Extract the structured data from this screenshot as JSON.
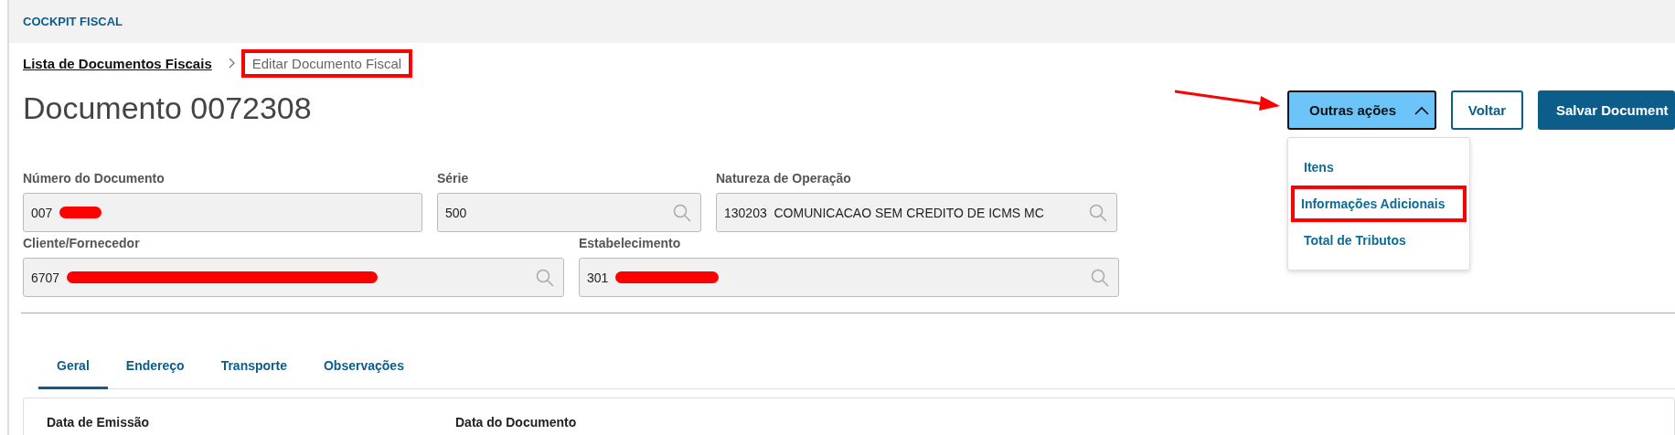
{
  "header": {
    "title": "COCKPIT FISCAL"
  },
  "breadcrumb": [
    {
      "label": "Lista de Documentos Fiscais",
      "current": false,
      "highlighted": false
    },
    {
      "label": "Editar Documento Fiscal",
      "current": true,
      "highlighted": true
    }
  ],
  "page_title": "Documento 0072308",
  "actions": [
    {
      "label": "Outras ações",
      "kind": "dropdown",
      "expanded": true,
      "pointed": true
    },
    {
      "label": "Voltar",
      "kind": "secondary",
      "pointed": false
    },
    {
      "label": "Salvar Document",
      "kind": "primary",
      "pointed": false
    }
  ],
  "dropdown_menu": [
    {
      "label": "Itens",
      "highlighted": false
    },
    {
      "label": "Informações Adicionais",
      "highlighted": true
    },
    {
      "label": "Total de Tributos",
      "highlighted": false
    }
  ],
  "field_rows": [
    [
      {
        "label": "Número do Documento",
        "value": "007",
        "redacted": true,
        "search": false
      },
      {
        "label": "Série",
        "value": "500",
        "redacted": false,
        "search": true
      },
      {
        "label": "Natureza de Operação",
        "value": "130203  COMUNICACAO SEM CREDITO DE ICMS MC",
        "redacted": false,
        "search": true
      }
    ],
    [
      {
        "label": "Cliente/Fornecedor",
        "value": "6707",
        "redacted": true,
        "search": true
      },
      {
        "label": "Estabelecimento",
        "value": "301",
        "redacted": true,
        "search": true
      }
    ]
  ],
  "tabs": [
    {
      "label": "Geral",
      "selected": true
    },
    {
      "label": "Endereço",
      "selected": false
    },
    {
      "label": "Transporte",
      "selected": false
    },
    {
      "label": "Observações",
      "selected": false
    }
  ],
  "tab_panel": {
    "labels": [
      "Data de Emissão",
      "Data do Documento"
    ]
  }
}
